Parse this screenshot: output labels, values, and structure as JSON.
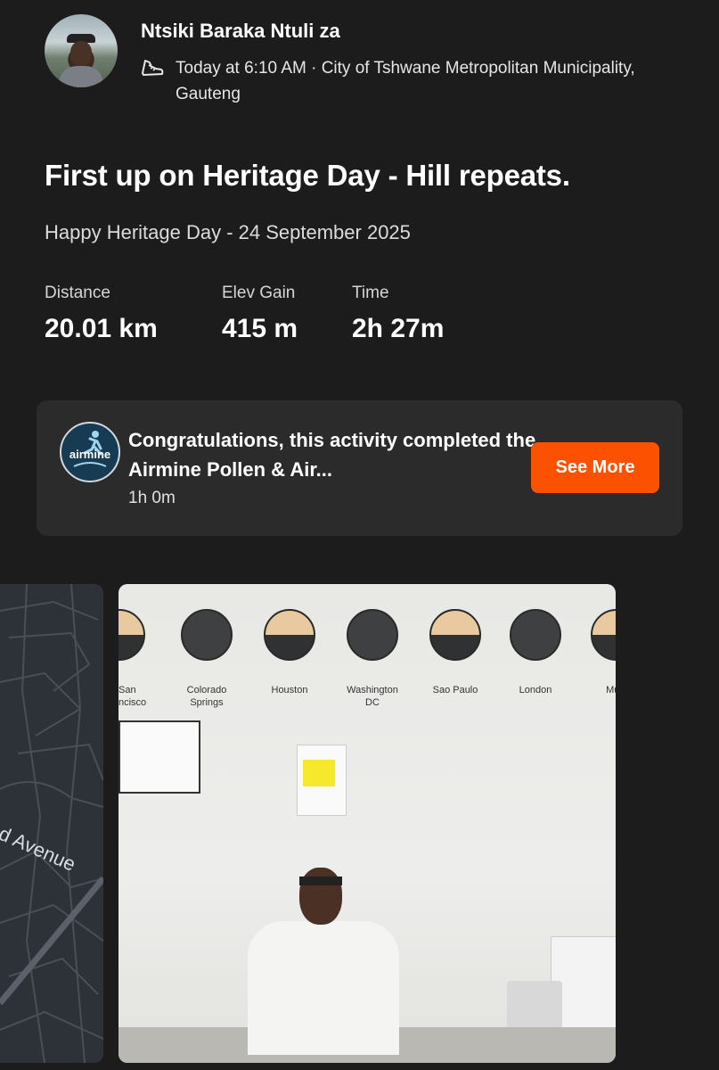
{
  "post": {
    "author": "Ntsiki Baraka Ntuli za",
    "meta": "Today at 6:10 AM · City of Tshwane Metropolitan Municipality, Gauteng",
    "title": "First up on Heritage Day - Hill repeats.",
    "description": "Happy Heritage Day - 24 September 2025"
  },
  "stats": [
    {
      "label": "Distance",
      "value": "20.01 km"
    },
    {
      "label": "Elev Gain",
      "value": "415 m"
    },
    {
      "label": "Time",
      "value": "2h 27m"
    }
  ],
  "challenge": {
    "badge_text": "airmine",
    "message": "Congratulations, this activity completed the Airmine Pollen & Air...",
    "duration": "1h 0m",
    "button": "See More"
  },
  "map": {
    "street_label": "nd Avenue"
  },
  "photo": {
    "cities": [
      "San\nncisco",
      "Colorado\nSprings",
      "Houston",
      "Washington\nDC",
      "Sao Paulo",
      "London",
      "Muni"
    ]
  },
  "colors": {
    "background": "#1c1c1c",
    "card": "#2b2b2b",
    "accent": "#fc5200"
  }
}
